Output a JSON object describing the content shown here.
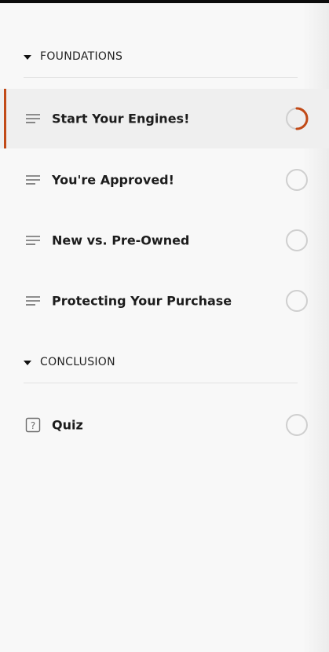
{
  "outline": {
    "sections": [
      {
        "title": "FOUNDATIONS",
        "lessons": [
          {
            "label": "Start Your Engines!",
            "icon": "lines-icon",
            "progress": 0.5,
            "active": true
          },
          {
            "label": "You're Approved!",
            "icon": "lines-icon",
            "progress": 0
          },
          {
            "label": "New vs. Pre-Owned",
            "icon": "lines-icon",
            "progress": 0
          },
          {
            "label": "Protecting Your Purchase",
            "icon": "lines-icon",
            "progress": 0
          }
        ]
      },
      {
        "title": "CONCLUSION",
        "lessons": [
          {
            "label": "Quiz",
            "icon": "question-box-icon",
            "progress": 0
          }
        ]
      }
    ]
  },
  "colors": {
    "accent": "#c14a17",
    "ring": "#cfcfcf",
    "text": "#1c1c1c",
    "active_row": "#efefef"
  }
}
